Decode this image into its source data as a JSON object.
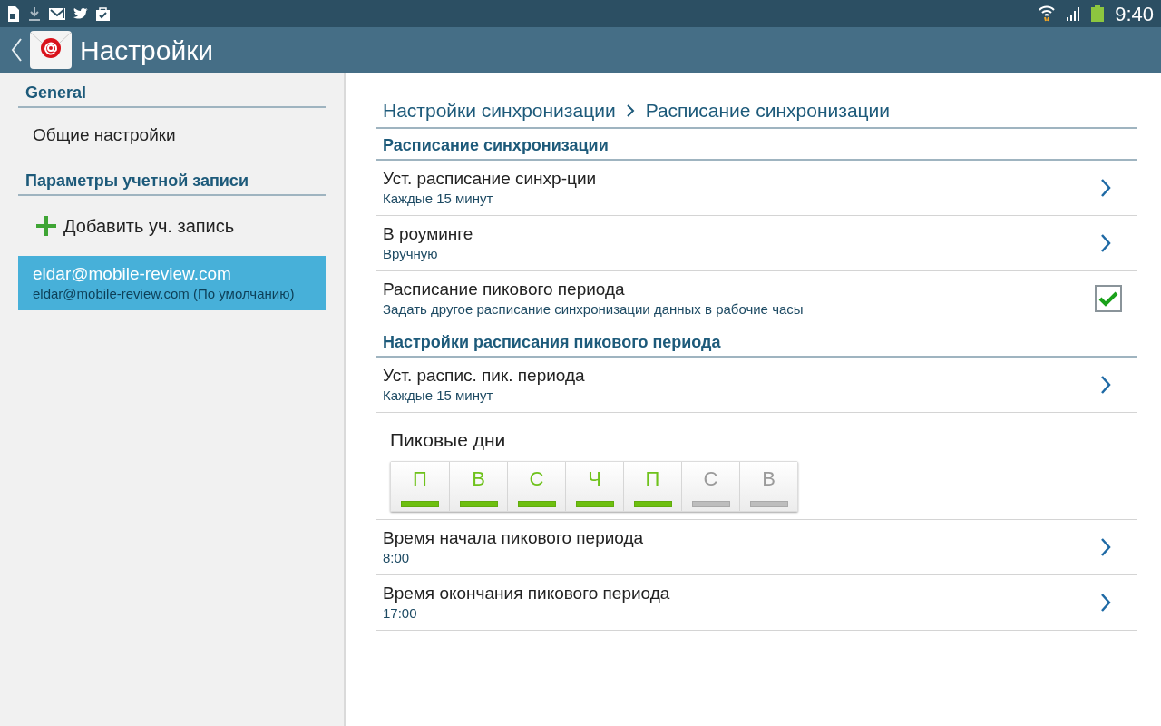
{
  "status_bar": {
    "time": "9:40"
  },
  "app_bar": {
    "title": "Настройки"
  },
  "sidebar": {
    "sections": [
      {
        "header": "General",
        "items": [
          {
            "kind": "plain",
            "title": "Общие настройки",
            "selected": false
          }
        ]
      },
      {
        "header": "Параметры учетной записи",
        "items": [
          {
            "kind": "add",
            "title": "Добавить уч. запись",
            "selected": false
          },
          {
            "kind": "account",
            "title": "eldar@mobile-review.com",
            "subtitle": "eldar@mobile-review.com (По умолчанию)",
            "selected": true
          }
        ]
      }
    ]
  },
  "breadcrumb": [
    "Настройки синхронизации",
    "Расписание синхронизации"
  ],
  "rows": [
    {
      "kind": "header",
      "title": "Расписание синхронизации"
    },
    {
      "kind": "nav",
      "title": "Уст. расписание синхр-ции",
      "subtitle": "Каждые 15 минут"
    },
    {
      "kind": "nav",
      "title": "В роуминге",
      "subtitle": "Вручную"
    },
    {
      "kind": "checkbox",
      "title": "Расписание пикового периода",
      "subtitle": "Задать другое расписание синхронизации данных в рабочие часы",
      "checked": true
    },
    {
      "kind": "header",
      "title": "Настройки расписания пикового периода"
    },
    {
      "kind": "nav",
      "title": "Уст. распис. пик. периода",
      "subtitle": "Каждые 15 минут"
    },
    {
      "kind": "days",
      "title": "Пиковые дни",
      "days": [
        {
          "label": "П",
          "on": true
        },
        {
          "label": "В",
          "on": true
        },
        {
          "label": "С",
          "on": true
        },
        {
          "label": "Ч",
          "on": true
        },
        {
          "label": "П",
          "on": true
        },
        {
          "label": "С",
          "on": false
        },
        {
          "label": "В",
          "on": false
        }
      ]
    },
    {
      "kind": "nav",
      "title": "Время начала пикового периода",
      "subtitle": "8:00"
    },
    {
      "kind": "nav",
      "title": "Время окончания пикового периода",
      "subtitle": "17:00"
    }
  ]
}
